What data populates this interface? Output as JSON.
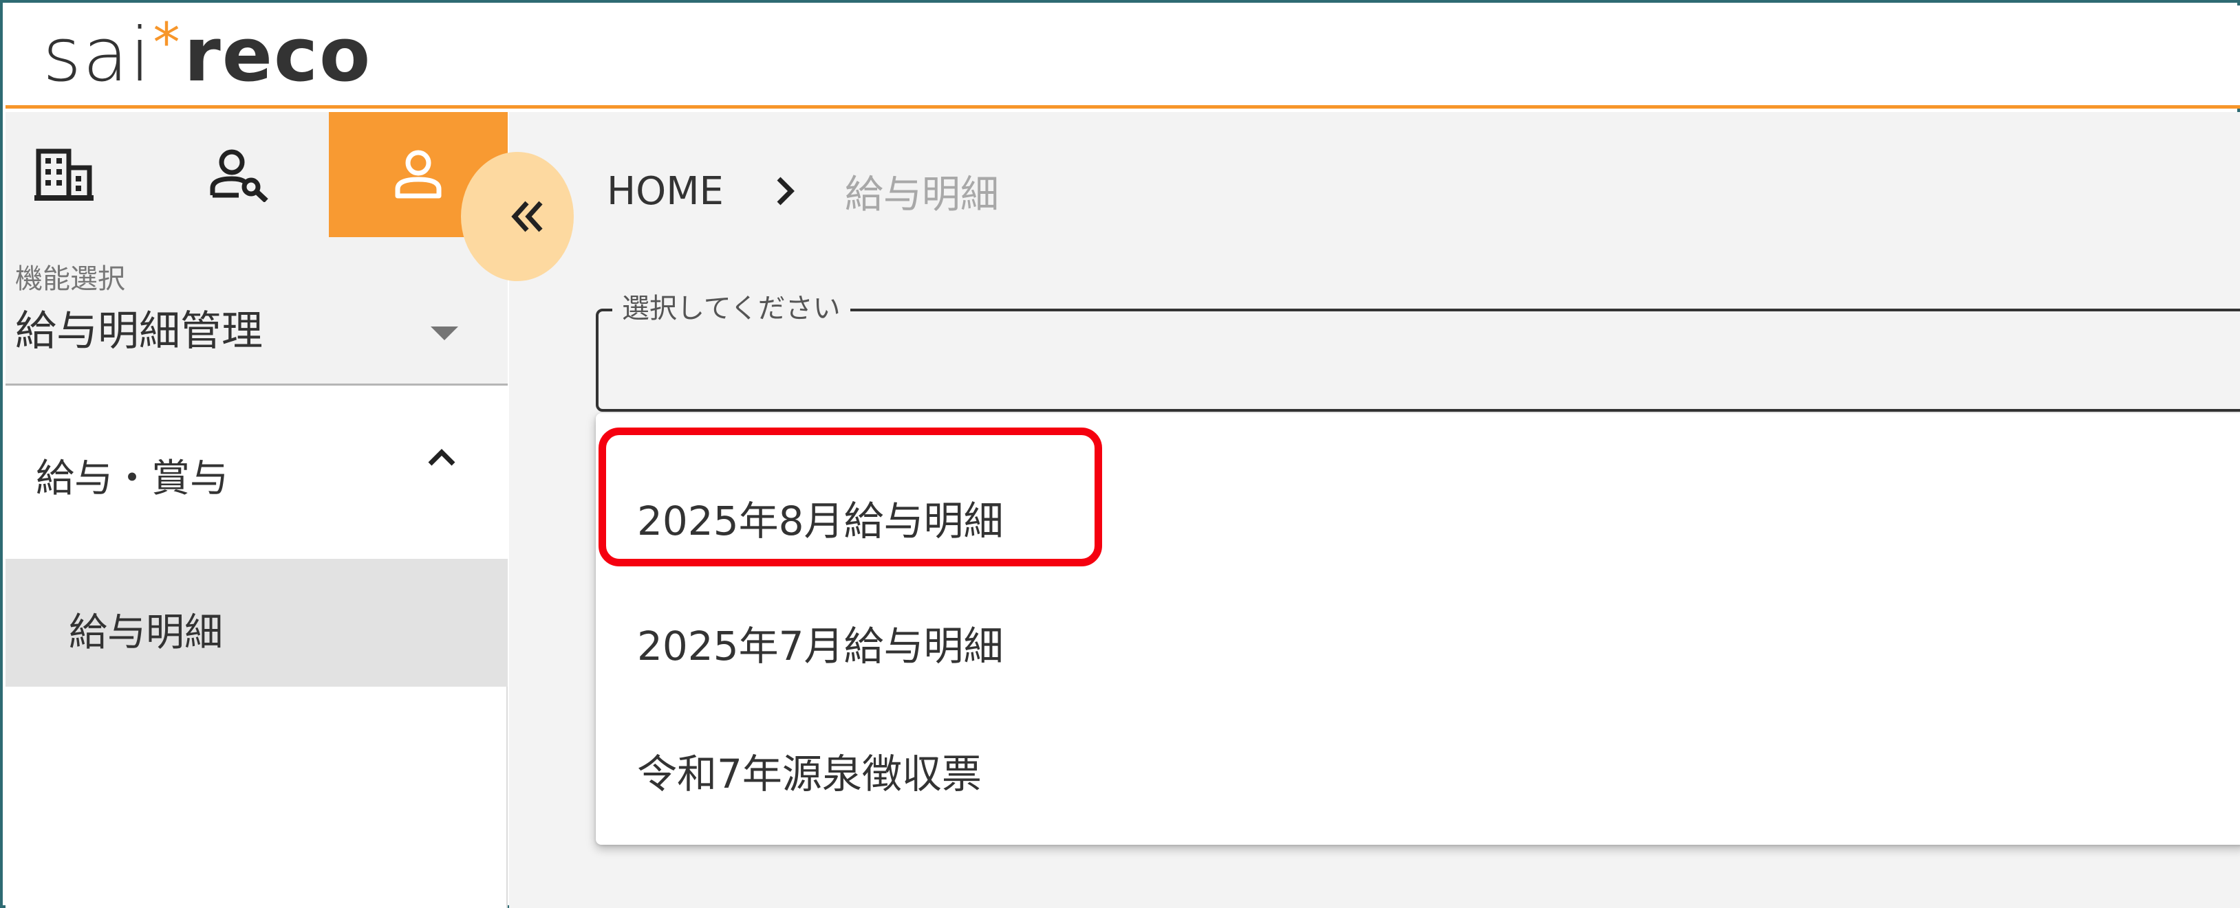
{
  "header": {
    "logo_light": "sai",
    "logo_star": "*",
    "logo_bold": "reco"
  },
  "sidebar": {
    "tabs": [
      {
        "icon": "building-icon",
        "active": false
      },
      {
        "icon": "user-settings-icon",
        "active": false
      },
      {
        "icon": "user-icon",
        "active": true
      }
    ],
    "function_select": {
      "label": "機能選択",
      "value": "給与明細管理"
    },
    "group": {
      "label": "給与・賞与",
      "expanded": true
    },
    "items": [
      {
        "label": "給与明細",
        "selected": true
      }
    ]
  },
  "main": {
    "breadcrumb": {
      "home": "HOME",
      "current": "給与明細"
    },
    "select": {
      "label": "選択してください",
      "value": ""
    },
    "options": [
      {
        "label": "2025年8月給与明細",
        "highlighted": true
      },
      {
        "label": "2025年7月給与明細",
        "highlighted": false
      },
      {
        "label": "令和7年源泉徴収票",
        "highlighted": false
      }
    ]
  },
  "colors": {
    "accent": "#f89a32",
    "header_border": "#f7962a",
    "collapse_button": "#fdd9a0",
    "highlight": "#f5000f",
    "frame": "#2e6b73"
  }
}
